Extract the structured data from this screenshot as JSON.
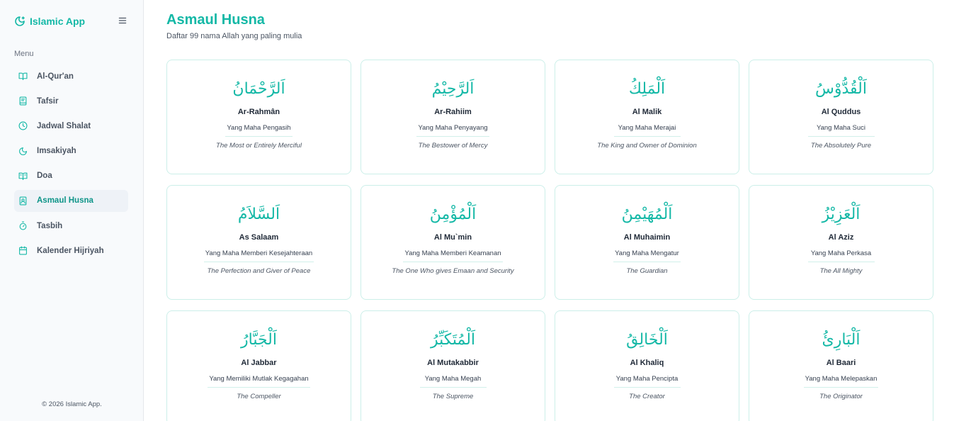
{
  "app": {
    "title": "Islamic App"
  },
  "sidebar": {
    "menu_heading": "Menu",
    "items": [
      {
        "label": "Al-Qur'an",
        "icon": "book-open-icon",
        "active": false
      },
      {
        "label": "Tafsir",
        "icon": "book-icon",
        "active": false
      },
      {
        "label": "Jadwal Shalat",
        "icon": "clock-icon",
        "active": false
      },
      {
        "label": "Imsakiyah",
        "icon": "moon-icon",
        "active": false
      },
      {
        "label": "Doa",
        "icon": "book-text-icon",
        "active": false
      },
      {
        "label": "Asmaul Husna",
        "icon": "book-user-icon",
        "active": true
      },
      {
        "label": "Tasbih",
        "icon": "timer-icon",
        "active": false
      },
      {
        "label": "Kalender Hijriyah",
        "icon": "calendar-icon",
        "active": false
      }
    ],
    "copyright": "© 2026 Islamic App."
  },
  "page": {
    "title": "Asmaul Husna",
    "subtitle": "Daftar 99 nama Allah yang paling mulia"
  },
  "names": [
    {
      "arabic": "اَلرَّحْمَانُ",
      "latin": "Ar-Rahmân",
      "meaning": "Yang Maha Pengasih",
      "english": "The Most or Entirely Merciful"
    },
    {
      "arabic": "اَلرَّحِيْمُ",
      "latin": "Ar-Rahiim",
      "meaning": "Yang Maha Penyayang",
      "english": "The Bestower of Mercy"
    },
    {
      "arabic": "اَلْمَلِكُ",
      "latin": "Al Malik",
      "meaning": "Yang Maha Merajai",
      "english": "The King and Owner of Dominion"
    },
    {
      "arabic": "اَلْقُدُّوْسُ",
      "latin": "Al Quddus",
      "meaning": "Yang Maha Suci",
      "english": "The Absolutely Pure"
    },
    {
      "arabic": "اَلسَّلاَمُ",
      "latin": "As Salaam",
      "meaning": "Yang Maha Memberi Kesejahteraan",
      "english": "The Perfection and Giver of Peace"
    },
    {
      "arabic": "اَلْمُؤْمِنُ",
      "latin": "Al Mu`min",
      "meaning": "Yang Maha Memberi Keamanan",
      "english": "The One Who gives Emaan and Security"
    },
    {
      "arabic": "اَلْمُهَيْمِنُ",
      "latin": "Al Muhaimin",
      "meaning": "Yang Maha Mengatur",
      "english": "The Guardian"
    },
    {
      "arabic": "اَلْعَزِيْزُ",
      "latin": "Al Aziz",
      "meaning": "Yang Maha Perkasa",
      "english": "The All Mighty"
    },
    {
      "arabic": "اَلْجَبَّارُ",
      "latin": "Al Jabbar",
      "meaning": "Yang Memiliki Mutlak Kegagahan",
      "english": "The Compeller"
    },
    {
      "arabic": "اَلْمُتَكَبِّرُ",
      "latin": "Al Mutakabbir",
      "meaning": "Yang Maha Megah",
      "english": "The Supreme"
    },
    {
      "arabic": "اَلْخَالِقُ",
      "latin": "Al Khaliq",
      "meaning": "Yang Maha Pencipta",
      "english": "The Creator"
    },
    {
      "arabic": "اَلْبَارِئُ",
      "latin": "Al Baari",
      "meaning": "Yang Maha Melepaskan",
      "english": "The Originator"
    }
  ],
  "colors": {
    "accent": "#14b8a6",
    "active_bg": "#eef2f7",
    "card_border": "#ccefe9"
  }
}
